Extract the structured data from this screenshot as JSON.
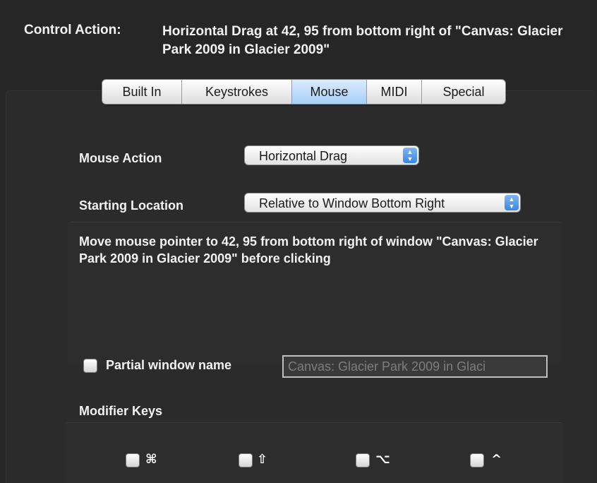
{
  "header": {
    "control_action_label": "Control Action:",
    "control_action_value": "Horizontal Drag at 42, 95 from bottom right of \"Canvas: Glacier Park 2009 in Glacier 2009\""
  },
  "tabs": [
    {
      "label": "Built In",
      "selected": false
    },
    {
      "label": "Keystrokes",
      "selected": false
    },
    {
      "label": "Mouse",
      "selected": true
    },
    {
      "label": "MIDI",
      "selected": false
    },
    {
      "label": "Special",
      "selected": false
    }
  ],
  "mouse_action": {
    "label": "Mouse Action",
    "value": "Horizontal Drag"
  },
  "starting_location": {
    "label": "Starting Location",
    "value": "Relative to Window Bottom Right"
  },
  "description": "Move mouse pointer to 42, 95 from bottom right of window \"Canvas: Glacier Park 2009 in Glacier 2009\" before clicking",
  "partial_window": {
    "label": "Partial window name",
    "checked": false,
    "field_value": "Canvas: Glacier Park 2009 in Glaci"
  },
  "modifiers": {
    "label": "Modifier Keys",
    "keys": [
      {
        "glyph": "⌘",
        "icon": "command-icon",
        "checked": false
      },
      {
        "glyph": "⇧",
        "icon": "shift-icon",
        "checked": false
      },
      {
        "glyph": "⌥",
        "icon": "option-icon",
        "checked": false
      },
      {
        "glyph": "^",
        "icon": "control-icon",
        "checked": false
      }
    ]
  },
  "colors": {
    "background": "#262626",
    "selected_tab": "#a9cff7",
    "popup_arrow": "#3a86e0"
  }
}
